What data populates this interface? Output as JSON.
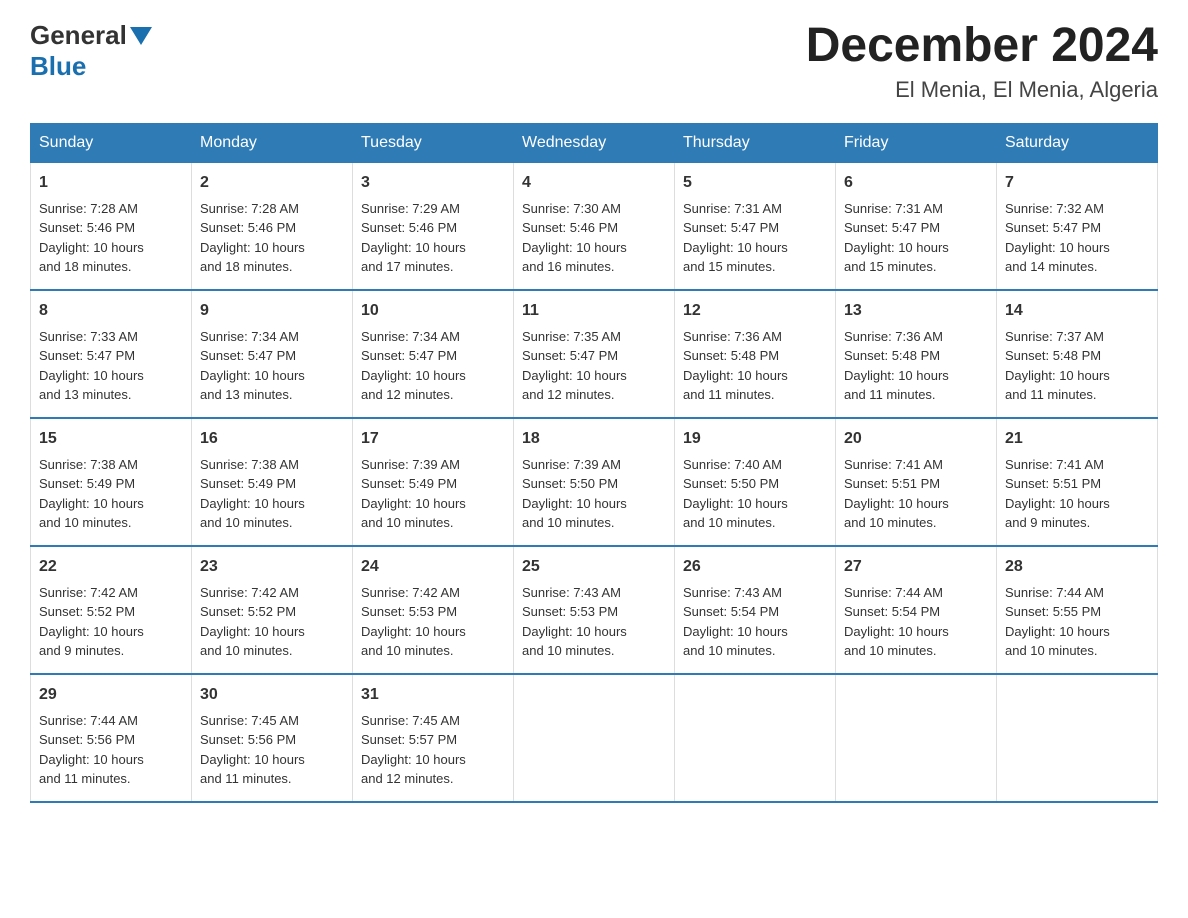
{
  "header": {
    "logo_general": "General",
    "logo_blue": "Blue",
    "month_year": "December 2024",
    "location": "El Menia, El Menia, Algeria"
  },
  "days_of_week": [
    "Sunday",
    "Monday",
    "Tuesday",
    "Wednesday",
    "Thursday",
    "Friday",
    "Saturday"
  ],
  "weeks": [
    [
      {
        "day": "1",
        "sunrise": "7:28 AM",
        "sunset": "5:46 PM",
        "daylight": "10 hours and 18 minutes."
      },
      {
        "day": "2",
        "sunrise": "7:28 AM",
        "sunset": "5:46 PM",
        "daylight": "10 hours and 18 minutes."
      },
      {
        "day": "3",
        "sunrise": "7:29 AM",
        "sunset": "5:46 PM",
        "daylight": "10 hours and 17 minutes."
      },
      {
        "day": "4",
        "sunrise": "7:30 AM",
        "sunset": "5:46 PM",
        "daylight": "10 hours and 16 minutes."
      },
      {
        "day": "5",
        "sunrise": "7:31 AM",
        "sunset": "5:47 PM",
        "daylight": "10 hours and 15 minutes."
      },
      {
        "day": "6",
        "sunrise": "7:31 AM",
        "sunset": "5:47 PM",
        "daylight": "10 hours and 15 minutes."
      },
      {
        "day": "7",
        "sunrise": "7:32 AM",
        "sunset": "5:47 PM",
        "daylight": "10 hours and 14 minutes."
      }
    ],
    [
      {
        "day": "8",
        "sunrise": "7:33 AM",
        "sunset": "5:47 PM",
        "daylight": "10 hours and 13 minutes."
      },
      {
        "day": "9",
        "sunrise": "7:34 AM",
        "sunset": "5:47 PM",
        "daylight": "10 hours and 13 minutes."
      },
      {
        "day": "10",
        "sunrise": "7:34 AM",
        "sunset": "5:47 PM",
        "daylight": "10 hours and 12 minutes."
      },
      {
        "day": "11",
        "sunrise": "7:35 AM",
        "sunset": "5:47 PM",
        "daylight": "10 hours and 12 minutes."
      },
      {
        "day": "12",
        "sunrise": "7:36 AM",
        "sunset": "5:48 PM",
        "daylight": "10 hours and 11 minutes."
      },
      {
        "day": "13",
        "sunrise": "7:36 AM",
        "sunset": "5:48 PM",
        "daylight": "10 hours and 11 minutes."
      },
      {
        "day": "14",
        "sunrise": "7:37 AM",
        "sunset": "5:48 PM",
        "daylight": "10 hours and 11 minutes."
      }
    ],
    [
      {
        "day": "15",
        "sunrise": "7:38 AM",
        "sunset": "5:49 PM",
        "daylight": "10 hours and 10 minutes."
      },
      {
        "day": "16",
        "sunrise": "7:38 AM",
        "sunset": "5:49 PM",
        "daylight": "10 hours and 10 minutes."
      },
      {
        "day": "17",
        "sunrise": "7:39 AM",
        "sunset": "5:49 PM",
        "daylight": "10 hours and 10 minutes."
      },
      {
        "day": "18",
        "sunrise": "7:39 AM",
        "sunset": "5:50 PM",
        "daylight": "10 hours and 10 minutes."
      },
      {
        "day": "19",
        "sunrise": "7:40 AM",
        "sunset": "5:50 PM",
        "daylight": "10 hours and 10 minutes."
      },
      {
        "day": "20",
        "sunrise": "7:41 AM",
        "sunset": "5:51 PM",
        "daylight": "10 hours and 10 minutes."
      },
      {
        "day": "21",
        "sunrise": "7:41 AM",
        "sunset": "5:51 PM",
        "daylight": "10 hours and 9 minutes."
      }
    ],
    [
      {
        "day": "22",
        "sunrise": "7:42 AM",
        "sunset": "5:52 PM",
        "daylight": "10 hours and 9 minutes."
      },
      {
        "day": "23",
        "sunrise": "7:42 AM",
        "sunset": "5:52 PM",
        "daylight": "10 hours and 10 minutes."
      },
      {
        "day": "24",
        "sunrise": "7:42 AM",
        "sunset": "5:53 PM",
        "daylight": "10 hours and 10 minutes."
      },
      {
        "day": "25",
        "sunrise": "7:43 AM",
        "sunset": "5:53 PM",
        "daylight": "10 hours and 10 minutes."
      },
      {
        "day": "26",
        "sunrise": "7:43 AM",
        "sunset": "5:54 PM",
        "daylight": "10 hours and 10 minutes."
      },
      {
        "day": "27",
        "sunrise": "7:44 AM",
        "sunset": "5:54 PM",
        "daylight": "10 hours and 10 minutes."
      },
      {
        "day": "28",
        "sunrise": "7:44 AM",
        "sunset": "5:55 PM",
        "daylight": "10 hours and 10 minutes."
      }
    ],
    [
      {
        "day": "29",
        "sunrise": "7:44 AM",
        "sunset": "5:56 PM",
        "daylight": "10 hours and 11 minutes."
      },
      {
        "day": "30",
        "sunrise": "7:45 AM",
        "sunset": "5:56 PM",
        "daylight": "10 hours and 11 minutes."
      },
      {
        "day": "31",
        "sunrise": "7:45 AM",
        "sunset": "5:57 PM",
        "daylight": "10 hours and 12 minutes."
      },
      null,
      null,
      null,
      null
    ]
  ],
  "labels": {
    "sunrise": "Sunrise:",
    "sunset": "Sunset:",
    "daylight": "Daylight:"
  }
}
